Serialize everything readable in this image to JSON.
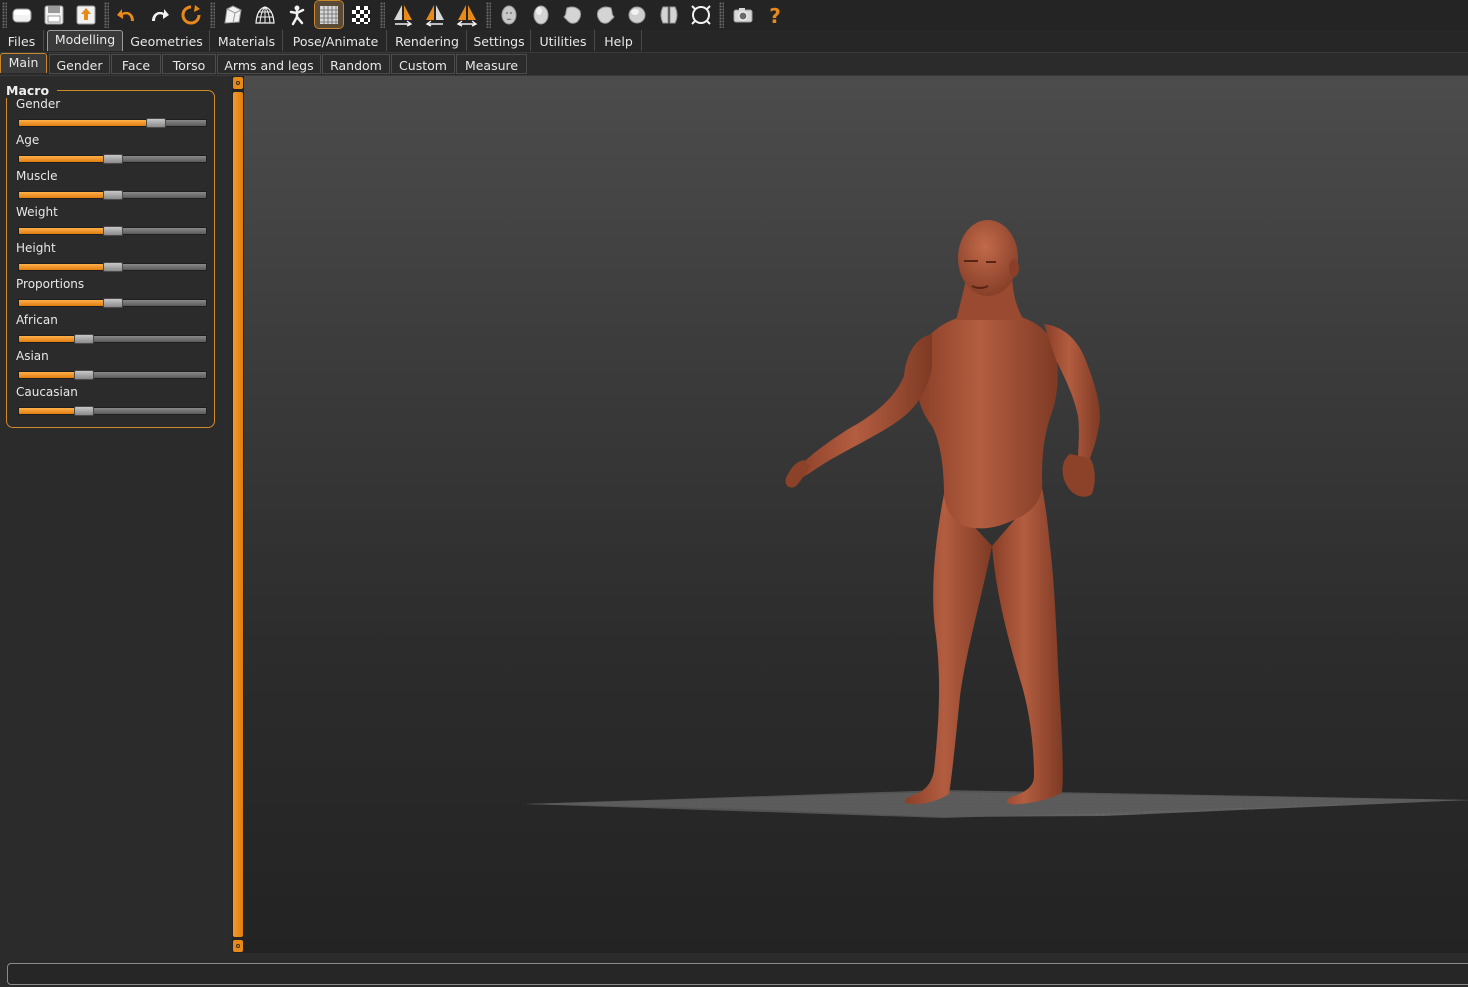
{
  "colors": {
    "accent": "#e88a1a",
    "skin": "#a8553a",
    "panel_bg": "#2b2b2b",
    "viewport_top": "#4c4c4c",
    "viewport_bottom": "#232323"
  },
  "toolbar": {
    "buttons": [
      {
        "icon": "new-file-icon"
      },
      {
        "icon": "save-icon"
      },
      {
        "icon": "export-icon"
      },
      {
        "icon": "undo-icon"
      },
      {
        "icon": "redo-icon"
      },
      {
        "icon": "reset-icon"
      },
      {
        "icon": "smooth-icon"
      },
      {
        "icon": "wireframe-icon"
      },
      {
        "icon": "pose-icon"
      },
      {
        "icon": "grid-icon",
        "active": true
      },
      {
        "icon": "background-icon"
      },
      {
        "icon": "symmetry-right-icon"
      },
      {
        "icon": "symmetry-left-icon"
      },
      {
        "icon": "symmetry-icon"
      },
      {
        "icon": "front-view-icon"
      },
      {
        "icon": "back-view-icon"
      },
      {
        "icon": "left-view-icon"
      },
      {
        "icon": "right-view-icon"
      },
      {
        "icon": "top-view-icon"
      },
      {
        "icon": "bottom-view-icon"
      },
      {
        "icon": "reset-camera-icon"
      },
      {
        "icon": "screenshot-icon"
      },
      {
        "icon": "help-icon"
      }
    ]
  },
  "menu": {
    "tabs": [
      "Files",
      "Modelling",
      "Geometries",
      "Materials",
      "Pose/Animate",
      "Rendering",
      "Settings",
      "Utilities",
      "Help"
    ],
    "selected": "Modelling"
  },
  "subtabs": {
    "tabs": [
      "Main",
      "Gender",
      "Face",
      "Torso",
      "Arms and legs",
      "Random",
      "Custom",
      "Measure"
    ],
    "selected": "Main"
  },
  "macro": {
    "title": "Macro",
    "sliders": [
      {
        "label": "Gender",
        "value": 0.73
      },
      {
        "label": "Age",
        "value": 0.5
      },
      {
        "label": "Muscle",
        "value": 0.5
      },
      {
        "label": "Weight",
        "value": 0.5
      },
      {
        "label": "Height",
        "value": 0.5
      },
      {
        "label": "Proportions",
        "value": 0.5
      },
      {
        "label": "African",
        "value": 0.35
      },
      {
        "label": "Asian",
        "value": 0.35
      },
      {
        "label": "Caucasian",
        "value": 0.35
      }
    ]
  },
  "status": {
    "text": ""
  }
}
